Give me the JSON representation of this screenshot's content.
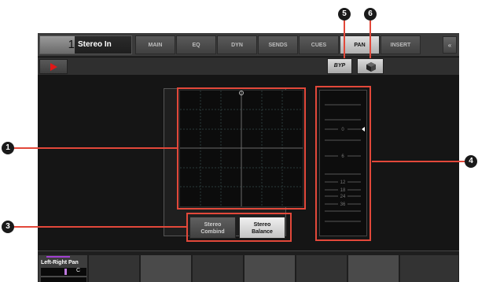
{
  "channel": {
    "number": "1",
    "name": "Stereo In"
  },
  "tabs": [
    {
      "label": "MAIN",
      "active": false
    },
    {
      "label": "EQ",
      "active": false
    },
    {
      "label": "DYN",
      "active": false
    },
    {
      "label": "SENDS",
      "active": false
    },
    {
      "label": "CUES",
      "active": false
    },
    {
      "label": "PAN",
      "active": true
    },
    {
      "label": "INSERT",
      "active": false
    }
  ],
  "side_button_icon": "collapse-arrows-icon",
  "toolbar": {
    "bypass_label": "BYP",
    "cube_icon": "cube-icon",
    "play_icon": "play-icon"
  },
  "pan_mode": {
    "left": {
      "line1": "Stereo",
      "line2": "Combind"
    },
    "right": {
      "line1": "Stereo",
      "line2": "Balance"
    },
    "selected": "right"
  },
  "width_scale": [
    "0",
    "6",
    "12",
    "18",
    "24",
    "36"
  ],
  "knob": {
    "label": "Left-Right Pan",
    "value": "C"
  },
  "callouts": [
    "1",
    "3",
    "4",
    "5",
    "6"
  ],
  "colors": {
    "callout_line": "#e2483a",
    "accent_purple": "#a040d0",
    "play_red": "#e01818"
  }
}
